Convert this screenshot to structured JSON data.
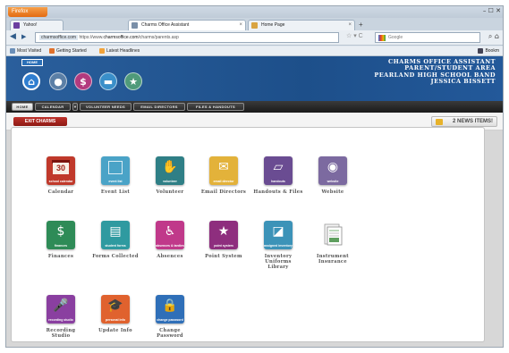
{
  "browser": {
    "app_button": "Firefox",
    "window_controls": "– ☐ ✕",
    "tabs": [
      {
        "label": "Yahoo!"
      },
      {
        "label": "Charms Office Assistant"
      },
      {
        "label": "Home Page"
      }
    ],
    "new_tab": "+",
    "url_domain": "charmsoffice.com",
    "url_scheme": "https://www.",
    "url_host": "charmsoffice.com",
    "url_path": "/charms/parents.asp",
    "search_placeholder": "Google",
    "bookmarks": [
      "Most Visited",
      "Getting Started",
      "Latest Headlines"
    ],
    "bookmarks_right": "Bookm"
  },
  "site": {
    "home_tile": "HOME",
    "header_lines": [
      "CHARMS OFFICE ASSISTANT",
      "PARENT/STUDENT AREA",
      "PEARLAND HIGH SCHOOL BAND",
      "JESSICA BISSETT"
    ],
    "round_buttons": [
      {
        "icon": "home-icon",
        "glyph": "⌂",
        "color": "#2f7ed0"
      },
      {
        "icon": "person-icon",
        "glyph": "👤",
        "color": "#5b7fa6"
      },
      {
        "icon": "dollar-icon",
        "glyph": "$",
        "color": "#b23a7e"
      },
      {
        "icon": "chat-icon",
        "glyph": "▬",
        "color": "#3a8fc9"
      },
      {
        "icon": "star-icon",
        "glyph": "★",
        "color": "#4f9a7a"
      }
    ],
    "nav": [
      "HOME",
      "CALENDAR",
      "VOLUNTEER NEEDS",
      "EMAIL DIRECTORS",
      "FILES & HANDOUTS"
    ],
    "exit_button": "EXIT CHARMS",
    "news_button": "2 NEWS ITEMS!"
  },
  "apps": [
    {
      "label": "Calendar",
      "cap": "school calendar",
      "color": "#c0392b",
      "icon": "calendar-icon",
      "glyph": ""
    },
    {
      "label": "Event List",
      "cap": "event list",
      "color": "#4aa3c7",
      "icon": "list-icon",
      "glyph": ""
    },
    {
      "label": "Volunteer",
      "cap": "volunteer",
      "color": "#2f7f86",
      "icon": "hand-icon",
      "glyph": "✋"
    },
    {
      "label": "Email Directors",
      "cap": "email director",
      "color": "#e3b23a",
      "icon": "envelope-icon",
      "glyph": "✉"
    },
    {
      "label": "Handouts & Files",
      "cap": "handouts",
      "color": "#6a4c92",
      "icon": "files-icon",
      "glyph": "▱"
    },
    {
      "label": "Website",
      "cap": "website",
      "color": "#7c6aa0",
      "icon": "mouse-icon",
      "glyph": "◉"
    },
    {
      "label": "Finances",
      "cap": "finances",
      "color": "#2e8b57",
      "icon": "dollar-icon",
      "glyph": "$"
    },
    {
      "label": "Forms Collected",
      "cap": "student forms",
      "color": "#2f9aa0",
      "icon": "form-icon",
      "glyph": "▤"
    },
    {
      "label": "Absences",
      "cap": "absences & tardies",
      "color": "#c0398a",
      "icon": "chair-icon",
      "glyph": "♿"
    },
    {
      "label": "Point System",
      "cap": "point system",
      "color": "#8e2e7e",
      "icon": "star-icon",
      "glyph": "★"
    },
    {
      "label": "Inventory\nUniforms\nLibrary",
      "cap": "assigned inventory",
      "color": "#3c93b8",
      "icon": "inventory-icon",
      "glyph": "◪"
    },
    {
      "label": "Instrument\nInsurance",
      "cap": "",
      "color": "#ffffff",
      "icon": "insurance-icon",
      "glyph": ""
    },
    {
      "label": "Recording\nStudio",
      "cap": "recording studio",
      "color": "#8a3fa0",
      "icon": "microphone-icon",
      "glyph": "🎤"
    },
    {
      "label": "Update Info",
      "cap": "personal info",
      "color": "#e0622e",
      "icon": "graduation-icon",
      "glyph": "🎓"
    },
    {
      "label": "Change\nPassword",
      "cap": "change password",
      "color": "#2f6fb8",
      "icon": "lock-icon",
      "glyph": "🔒"
    }
  ]
}
